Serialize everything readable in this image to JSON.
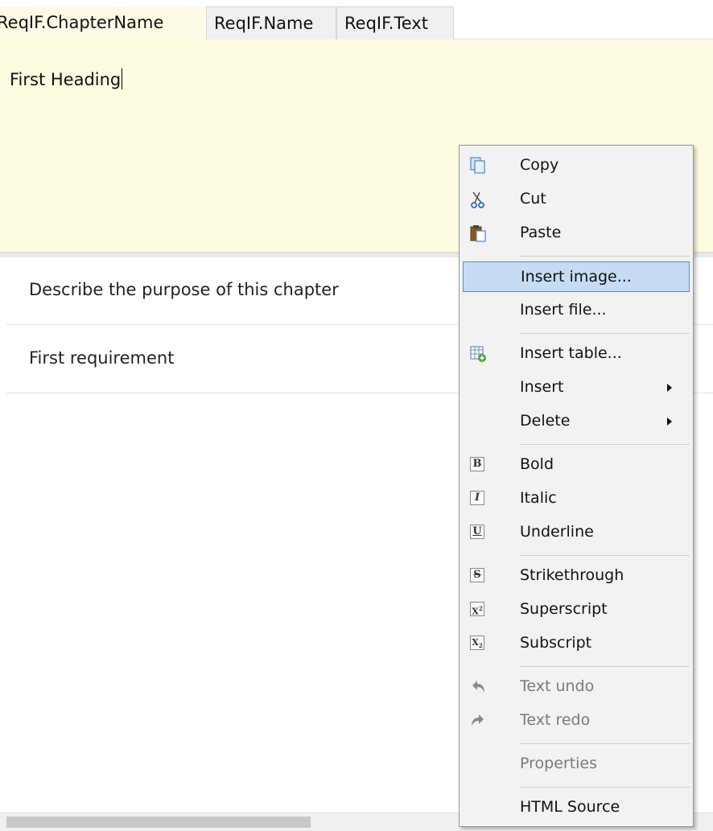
{
  "tabs": [
    "ReqIF.ChapterName",
    "ReqIF.Name",
    "ReqIF.Text"
  ],
  "editor": {
    "text": "First Heading"
  },
  "rows": [
    "Describe the purpose of this chapter",
    "First requirement"
  ],
  "menu": {
    "copy": "Copy",
    "cut": "Cut",
    "paste": "Paste",
    "insert_image": "Insert image...",
    "insert_file": "Insert file...",
    "insert_table": "Insert table...",
    "insert": "Insert",
    "delete": "Delete",
    "bold": "Bold",
    "italic": "Italic",
    "underline": "Underline",
    "strikethrough": "Strikethrough",
    "superscript": "Superscript",
    "subscript": "Subscript",
    "text_undo": "Text undo",
    "text_redo": "Text redo",
    "properties": "Properties",
    "html_source": "HTML Source"
  },
  "icons": {
    "copy": "copy-icon",
    "cut": "scissors-icon",
    "paste": "paste-icon",
    "table": "insert-table-icon",
    "bold": "bold-icon",
    "italic": "italic-icon",
    "underline": "underline-icon",
    "strike": "strikethrough-icon",
    "sup": "superscript-icon",
    "sub": "subscript-icon",
    "undo": "undo-icon",
    "redo": "redo-icon"
  },
  "colors": {
    "editor_bg": "#fdfbe0",
    "highlight": "#c6dcf2",
    "highlight_border": "#4f8fd1"
  }
}
